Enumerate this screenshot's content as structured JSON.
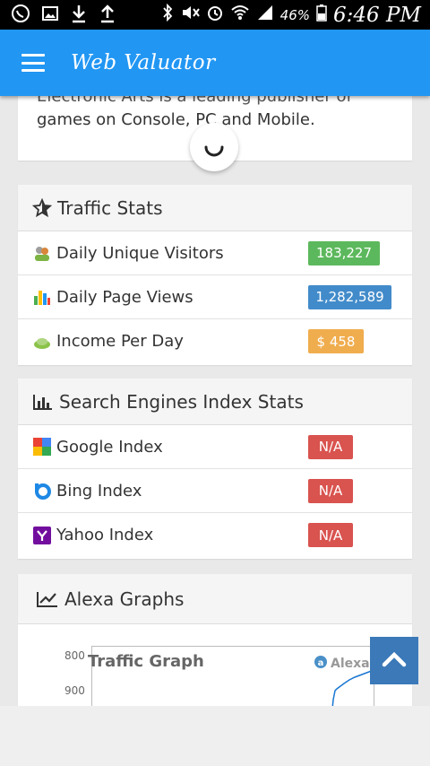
{
  "status_bar": {
    "battery_percent": "46%",
    "time": "6:46 PM",
    "left_icons": [
      "whatsapp-icon",
      "image-icon",
      "download-icon",
      "upload-icon"
    ],
    "right_icons": [
      "bluetooth-icon",
      "mute-icon",
      "alarm-icon",
      "wifi-icon",
      "signal-icon",
      "battery-icon"
    ]
  },
  "app_bar": {
    "title": "Web Valuator",
    "menu_icon": "hamburger-icon",
    "color": "#2196f3"
  },
  "description": {
    "cut_line": "Electronic Arts is a leading publisher of",
    "text": "games on Console, PC and Mobile."
  },
  "traffic_stats": {
    "title": "Traffic Stats",
    "icon": "star-icon",
    "rows": [
      {
        "label": "Daily Unique Visitors",
        "value": "183,227",
        "color": "#5cb85c",
        "icon": "visitors-icon"
      },
      {
        "label": "Daily Page Views",
        "value": "1,282,589",
        "color": "#428bca",
        "icon": "pageviews-icon"
      },
      {
        "label": "Income Per Day",
        "value": "$ 458",
        "color": "#f0ad4e",
        "icon": "income-icon"
      }
    ]
  },
  "search_stats": {
    "title": "Search Engines Index Stats",
    "icon": "bar-chart-icon",
    "rows": [
      {
        "label": "Google Index",
        "value": "N/A",
        "color": "#d9534f",
        "icon": "google-icon"
      },
      {
        "label": "Bing Index",
        "value": "N/A",
        "color": "#d9534f",
        "icon": "bing-icon"
      },
      {
        "label": "Yahoo Index",
        "value": "N/A",
        "color": "#d9534f",
        "icon": "yahoo-icon"
      }
    ]
  },
  "alexa": {
    "title": "Alexa Graphs",
    "icon": "line-chart-icon",
    "graph_title": "Traffic Graph",
    "brand": "Alexa",
    "y_ticks": [
      "800",
      "900"
    ]
  },
  "back_to_top": {
    "icon": "chevron-up-icon"
  }
}
